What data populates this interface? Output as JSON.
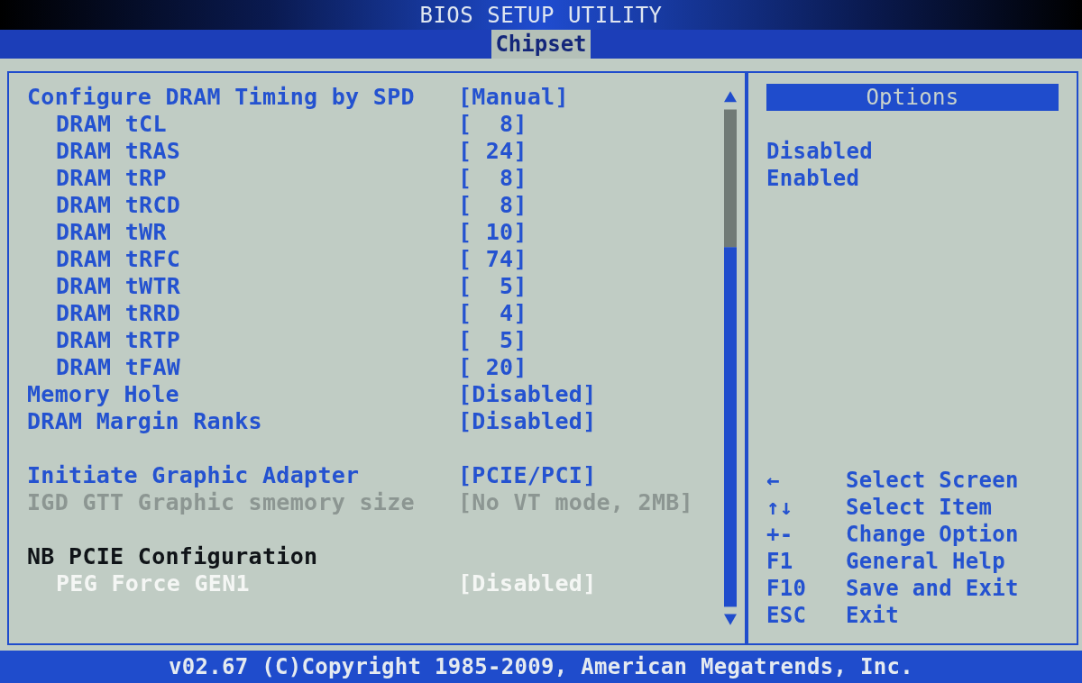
{
  "window": {
    "title": "BIOS SETUP UTILITY"
  },
  "tabs": [
    {
      "label": "Chipset",
      "selected": true
    }
  ],
  "settings": [
    {
      "kind": "setting",
      "label": "Configure DRAM Timing by SPD",
      "value": "[Manual]",
      "disabled": false,
      "selected": false,
      "children": [
        {
          "kind": "setting",
          "label": "DRAM tCL",
          "value": "[  8]",
          "disabled": false,
          "selected": false
        },
        {
          "kind": "setting",
          "label": "DRAM tRAS",
          "value": "[ 24]",
          "disabled": false,
          "selected": false
        },
        {
          "kind": "setting",
          "label": "DRAM tRP",
          "value": "[  8]",
          "disabled": false,
          "selected": false
        },
        {
          "kind": "setting",
          "label": "DRAM tRCD",
          "value": "[  8]",
          "disabled": false,
          "selected": false
        },
        {
          "kind": "setting",
          "label": "DRAM tWR",
          "value": "[ 10]",
          "disabled": false,
          "selected": false
        },
        {
          "kind": "setting",
          "label": "DRAM tRFC",
          "value": "[ 74]",
          "disabled": false,
          "selected": false
        },
        {
          "kind": "setting",
          "label": "DRAM tWTR",
          "value": "[  5]",
          "disabled": false,
          "selected": false
        },
        {
          "kind": "setting",
          "label": "DRAM tRRD",
          "value": "[  4]",
          "disabled": false,
          "selected": false
        },
        {
          "kind": "setting",
          "label": "DRAM tRTP",
          "value": "[  5]",
          "disabled": false,
          "selected": false
        },
        {
          "kind": "setting",
          "label": "DRAM tFAW",
          "value": "[ 20]",
          "disabled": false,
          "selected": false
        }
      ]
    },
    {
      "kind": "setting",
      "label": "Memory Hole",
      "value": "[Disabled]",
      "disabled": false,
      "selected": false
    },
    {
      "kind": "setting",
      "label": "DRAM Margin Ranks",
      "value": "[Disabled]",
      "disabled": false,
      "selected": false
    },
    {
      "kind": "gap"
    },
    {
      "kind": "setting",
      "label": "Initiate Graphic Adapter",
      "value": "[PCIE/PCI]",
      "disabled": false,
      "selected": false
    },
    {
      "kind": "setting",
      "label": "IGD GTT Graphic smemory size",
      "value": "[No VT mode, 2MB]",
      "disabled": true,
      "selected": false
    },
    {
      "kind": "gap"
    },
    {
      "kind": "header",
      "label": "NB PCIE Configuration",
      "children": [
        {
          "kind": "setting",
          "label": "PEG Force GEN1",
          "value": "[Disabled]",
          "disabled": false,
          "selected": true
        }
      ]
    }
  ],
  "options": {
    "title": "Options",
    "items": [
      "Disabled",
      "Enabled"
    ]
  },
  "keys": [
    {
      "key": "←",
      "action": "Select Screen"
    },
    {
      "key": "↑↓",
      "action": "Select Item"
    },
    {
      "key": "+-",
      "action": "Change Option"
    },
    {
      "key": "F1",
      "action": "General Help"
    },
    {
      "key": "F10",
      "action": "Save and Exit"
    },
    {
      "key": "ESC",
      "action": "Exit"
    }
  ],
  "footer": "v02.67 (C)Copyright 1985-2009, American Megatrends, Inc."
}
